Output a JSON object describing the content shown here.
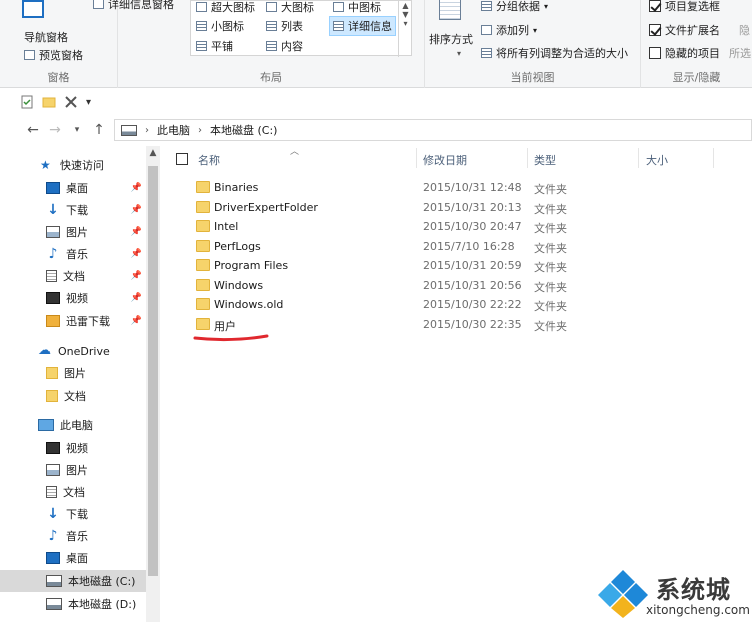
{
  "ribbon": {
    "pane": {
      "nav_pane_label": "导航窗格",
      "preview_label": "预览窗格",
      "details_label": "详细信息窗格",
      "group_label": "窗格"
    },
    "layout": {
      "items": [
        "超大图标",
        "大图标",
        "中图标",
        "小图标",
        "列表",
        "详细信息",
        "平铺",
        "内容"
      ],
      "group_label": "布局"
    },
    "current_view": {
      "sort_label": "排序方式",
      "group_by_label": "分组依据",
      "add_column_label": "添加列",
      "fit_columns_label": "将所有列调整为合适的大小",
      "group_label": "当前视图"
    },
    "show_hide": {
      "item_checkboxes_label": "项目复选框",
      "item_checkboxes_checked": true,
      "extensions_label": "文件扩展名",
      "extensions_checked": true,
      "hidden_items_label": "隐藏的项目",
      "hidden_items_checked": false,
      "selected_label": "所选",
      "hide_label": "隐",
      "group_label": "显示/隐藏"
    }
  },
  "address": {
    "segments": [
      "此电脑",
      "本地磁盘 (C:)"
    ]
  },
  "nav": {
    "quick_access": "快速访问",
    "quick_items": [
      "桌面",
      "下载",
      "图片",
      "音乐",
      "文档",
      "视频",
      "迅雷下载"
    ],
    "onedrive": "OneDrive",
    "onedrive_items": [
      "图片",
      "文档"
    ],
    "this_pc": "此电脑",
    "pc_items": [
      "视频",
      "图片",
      "文档",
      "下载",
      "音乐",
      "桌面",
      "本地磁盘 (C:)",
      "本地磁盘 (D:)"
    ]
  },
  "columns": {
    "name": "名称",
    "date": "修改日期",
    "type": "类型",
    "size": "大小"
  },
  "files": [
    {
      "name": "Binaries",
      "date": "2015/10/31 12:48",
      "type": "文件夹"
    },
    {
      "name": "DriverExpertFolder",
      "date": "2015/10/31 20:13",
      "type": "文件夹"
    },
    {
      "name": "Intel",
      "date": "2015/10/30 20:47",
      "type": "文件夹"
    },
    {
      "name": "PerfLogs",
      "date": "2015/7/10 16:28",
      "type": "文件夹"
    },
    {
      "name": "Program Files",
      "date": "2015/10/31 20:59",
      "type": "文件夹"
    },
    {
      "name": "Windows",
      "date": "2015/10/31 20:56",
      "type": "文件夹"
    },
    {
      "name": "Windows.old",
      "date": "2015/10/30 22:22",
      "type": "文件夹"
    },
    {
      "name": "用户",
      "date": "2015/10/30 22:35",
      "type": "文件夹"
    }
  ],
  "watermark": {
    "brand": "系统城",
    "url": "xitongcheng.com"
  },
  "colors": {
    "accent_blue": "#1e88d8",
    "folder_yellow": "#f6d36b",
    "highlight_red": "#e0282e"
  },
  "icons": {
    "qat": [
      "properties-icon",
      "new-folder-icon",
      "delete-icon",
      "dropdown-icon"
    ]
  }
}
